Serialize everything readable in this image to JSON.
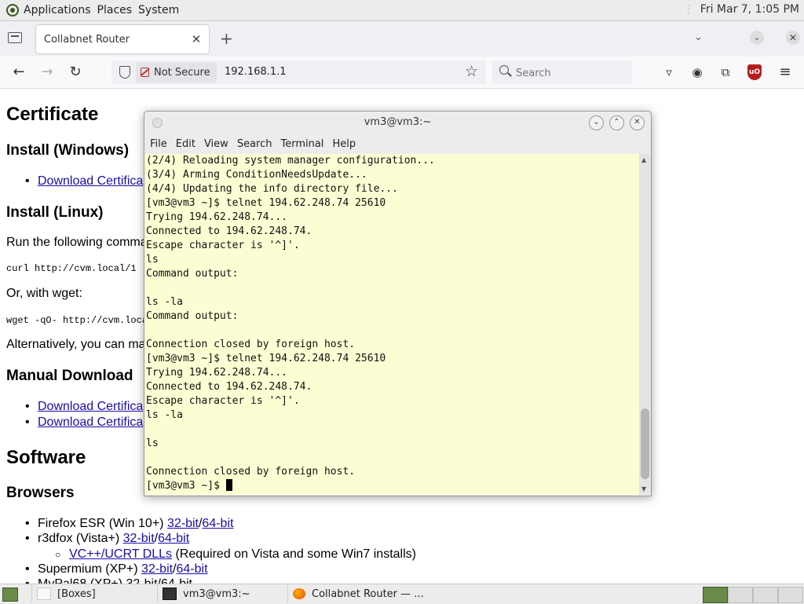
{
  "top_panel": {
    "menus": [
      "Applications",
      "Places",
      "System"
    ],
    "clock": "Fri Mar  7,  1:05 PM"
  },
  "browser": {
    "tab_title": "Collabnet Router",
    "not_secure_label": "Not Secure",
    "url": "192.168.1.1",
    "search_placeholder": "Search"
  },
  "page": {
    "h_certificate": "Certificate",
    "h_install_windows": "Install (Windows)",
    "link_download_cert_1": "Download Certifica",
    "h_install_linux": "Install (Linux)",
    "run_following": "Run the following comma",
    "curl_cmd": "curl http://cvm.local/1",
    "or_wget": "Or, with wget:",
    "wget_cmd": "wget -qO- http://cvm.loca",
    "alternatively": "Alternatively, you can ma",
    "h_manual_download": "Manual Download",
    "link_download_cert_2": "Download Certifica",
    "link_download_cert_3": "Download Certifica",
    "h_software": "Software",
    "h_browsers": "Browsers",
    "ff_label": "Firefox ESR (Win 10+) ",
    "r3d_label": "r3dfox (Vista+) ",
    "vc_link": "VC++/UCRT DLLs",
    "vc_note": " (Required on Vista and some Win7 installs)",
    "sup_label": "Supermium (XP+) ",
    "link_32": "32-bit",
    "link_64": "64-bit",
    "slash": "/",
    "partial_line": "MyPal68 (XP+) 32-bit/64-bit"
  },
  "terminal": {
    "title": "vm3@vm3:~",
    "menu": [
      "File",
      "Edit",
      "View",
      "Search",
      "Terminal",
      "Help"
    ],
    "lines": [
      "(2/4) Reloading system manager configuration...",
      "(3/4) Arming ConditionNeedsUpdate...",
      "(4/4) Updating the info directory file...",
      "[vm3@vm3 ~]$ telnet 194.62.248.74 25610",
      "Trying 194.62.248.74...",
      "Connected to 194.62.248.74.",
      "Escape character is '^]'.",
      "ls",
      "Command output:",
      "",
      "ls -la",
      "Command output:",
      "",
      "Connection closed by foreign host.",
      "[vm3@vm3 ~]$ telnet 194.62.248.74 25610",
      "Trying 194.62.248.74...",
      "Connected to 194.62.248.74.",
      "Escape character is '^]'.",
      "ls -la",
      "",
      "ls",
      "",
      "Connection closed by foreign host."
    ],
    "prompt": "[vm3@vm3 ~]$ "
  },
  "taskbar": {
    "boxes": "[Boxes]",
    "terminal": "vm3@vm3:~",
    "firefox": "Collabnet Router — ..."
  }
}
